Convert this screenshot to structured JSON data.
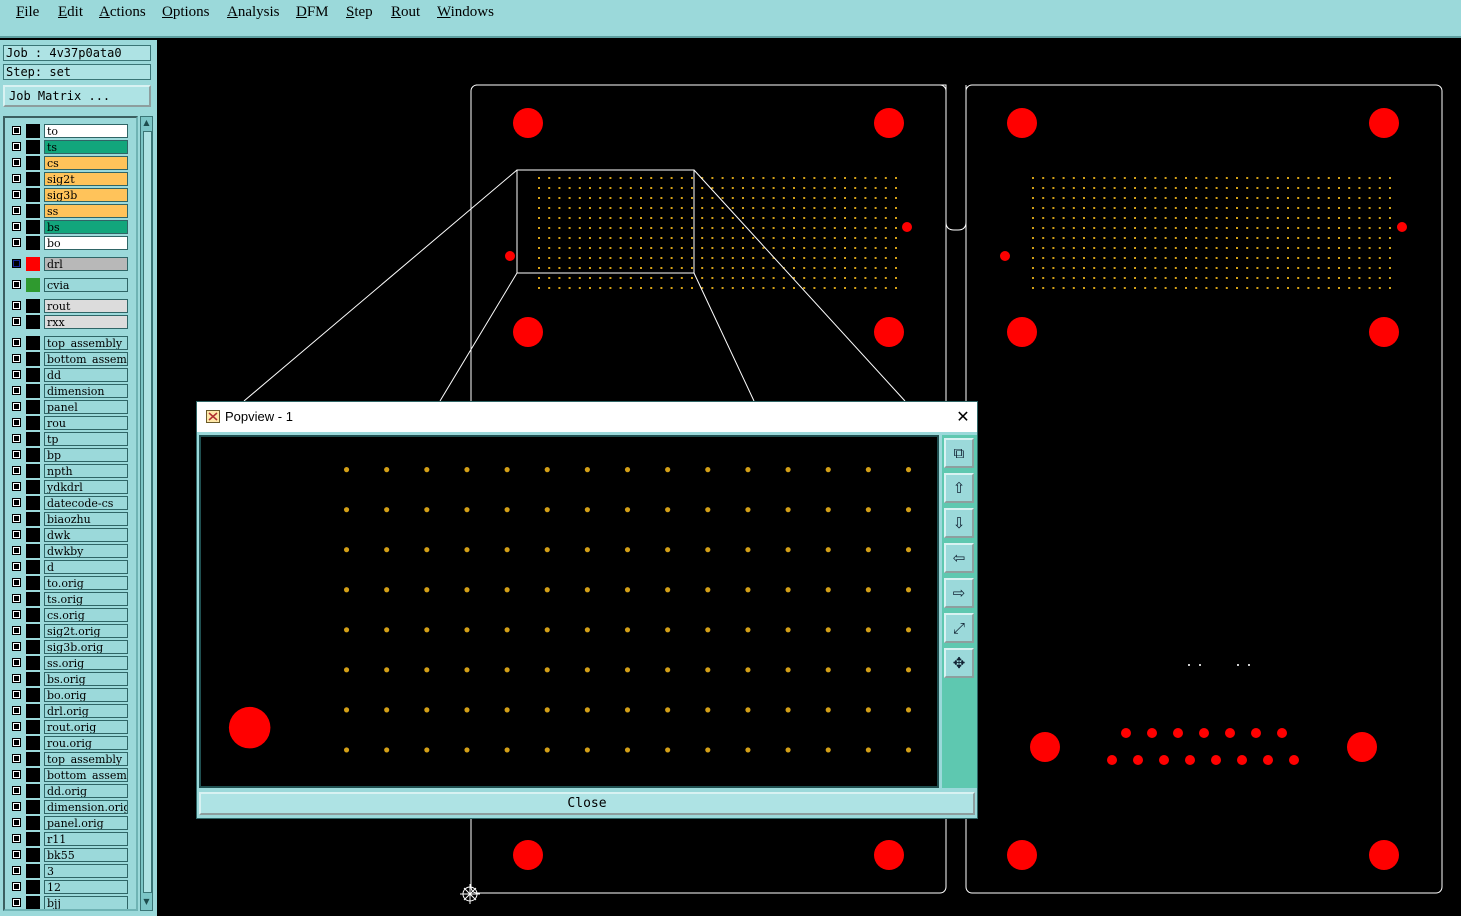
{
  "menubar": {
    "items": [
      "File",
      "Edit",
      "Actions",
      "Options",
      "Analysis",
      "DFM",
      "Step",
      "Rout",
      "Windows"
    ]
  },
  "job_info": {
    "job": "Job : 4v37p0ata0",
    "step": "Step: set"
  },
  "job_matrix_button": "Job Matrix ...",
  "layers": [
    {
      "name": "to",
      "color": "#ffffff"
    },
    {
      "name": "ts",
      "color": "#12a67c"
    },
    {
      "name": "cs",
      "color": "#ffc35a"
    },
    {
      "name": "sig2t",
      "color": "#ffc35a"
    },
    {
      "name": "sig3b",
      "color": "#ffc35a"
    },
    {
      "name": "ss",
      "color": "#ffc35a"
    },
    {
      "name": "bs",
      "color": "#12a67c"
    },
    {
      "name": "bo",
      "color": "#ffffff"
    },
    {
      "name": "drl",
      "color": "#b8b8b8",
      "active": true
    },
    {
      "name": "cvia",
      "color": "#9bd9da",
      "swatch": "#2f9a2f"
    },
    {
      "name": "rout",
      "color": "#dcdcdc"
    },
    {
      "name": "rxx",
      "color": "#dcdcdc"
    },
    {
      "name": "top_assembly",
      "color": "#9bd9da"
    },
    {
      "name": "bottom_assembly",
      "color": "#9bd9da"
    },
    {
      "name": "dd",
      "color": "#9bd9da"
    },
    {
      "name": "dimension",
      "color": "#9bd9da"
    },
    {
      "name": "panel",
      "color": "#9bd9da"
    },
    {
      "name": "rou",
      "color": "#9bd9da"
    },
    {
      "name": "tp",
      "color": "#9bd9da"
    },
    {
      "name": "bp",
      "color": "#9bd9da"
    },
    {
      "name": "npth",
      "color": "#9bd9da"
    },
    {
      "name": "ydkdrl",
      "color": "#9bd9da"
    },
    {
      "name": "datecode-cs",
      "color": "#9bd9da"
    },
    {
      "name": "biaozhu",
      "color": "#9bd9da"
    },
    {
      "name": "dwk",
      "color": "#9bd9da"
    },
    {
      "name": "dwkby",
      "color": "#9bd9da"
    },
    {
      "name": "d",
      "color": "#9bd9da"
    },
    {
      "name": "to.orig",
      "color": "#9bd9da"
    },
    {
      "name": "ts.orig",
      "color": "#9bd9da"
    },
    {
      "name": "cs.orig",
      "color": "#9bd9da"
    },
    {
      "name": "sig2t.orig",
      "color": "#9bd9da"
    },
    {
      "name": "sig3b.orig",
      "color": "#9bd9da"
    },
    {
      "name": "ss.orig",
      "color": "#9bd9da"
    },
    {
      "name": "bs.orig",
      "color": "#9bd9da"
    },
    {
      "name": "bo.orig",
      "color": "#9bd9da"
    },
    {
      "name": "drl.orig",
      "color": "#9bd9da"
    },
    {
      "name": "rout.orig",
      "color": "#9bd9da"
    },
    {
      "name": "rou.orig",
      "color": "#9bd9da"
    },
    {
      "name": "top_assembly",
      "color": "#9bd9da"
    },
    {
      "name": "bottom_assembly",
      "color": "#9bd9da"
    },
    {
      "name": "dd.orig",
      "color": "#9bd9da"
    },
    {
      "name": "dimension.orig",
      "color": "#9bd9da"
    },
    {
      "name": "panel.orig",
      "color": "#9bd9da"
    },
    {
      "name": "r11",
      "color": "#9bd9da"
    },
    {
      "name": "bk55",
      "color": "#9bd9da"
    },
    {
      "name": "3",
      "color": "#9bd9da"
    },
    {
      "name": "12",
      "color": "#9bd9da"
    },
    {
      "name": "bjj",
      "color": "#9bd9da"
    }
  ],
  "colors": {
    "pad": "#ff0000",
    "via": "#d4a017",
    "outline": "#ffffff",
    "ui_bg": "#9bd9da"
  },
  "popview": {
    "title": "Popview - 1",
    "close_label": "Close",
    "tools": [
      "zoom-to-fit-icon",
      "pan-up-icon",
      "pan-down-icon",
      "pan-left-icon",
      "pan-right-icon",
      "zoom-out-icon",
      "zoom-in-icon"
    ]
  }
}
